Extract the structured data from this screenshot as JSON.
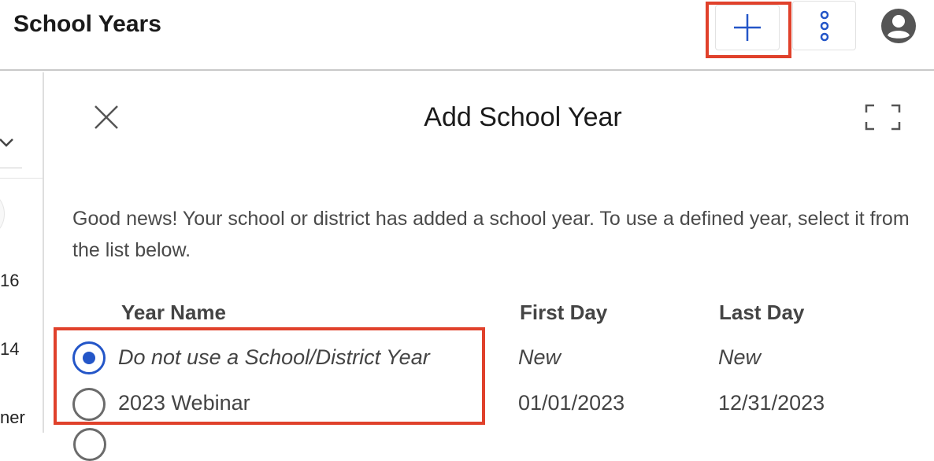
{
  "header": {
    "title": "School Years"
  },
  "left_panel": {
    "texts": [
      "16",
      "14",
      "ner"
    ]
  },
  "dialog": {
    "title": "Add School Year",
    "message": "Good news! Your school or district has added a school year. To use a defined year, select it from the list below.",
    "columns": {
      "year_name": "Year Name",
      "first_day": "First Day",
      "last_day": "Last Day"
    },
    "rows": [
      {
        "year_name": "Do not use a School/District Year",
        "first_day": "New",
        "last_day": "New",
        "selected": true
      },
      {
        "year_name": "2023 Webinar",
        "first_day": "01/01/2023",
        "last_day": "12/31/2023",
        "selected": false
      }
    ]
  },
  "icons": {
    "add": "plus-icon",
    "more": "more-vertical-icon",
    "account": "account-circle-icon",
    "close": "close-icon",
    "expand": "fullscreen-icon",
    "chevron": "chevron-down-icon"
  },
  "colors": {
    "accent": "#2456c8",
    "highlight": "#e0412b"
  }
}
